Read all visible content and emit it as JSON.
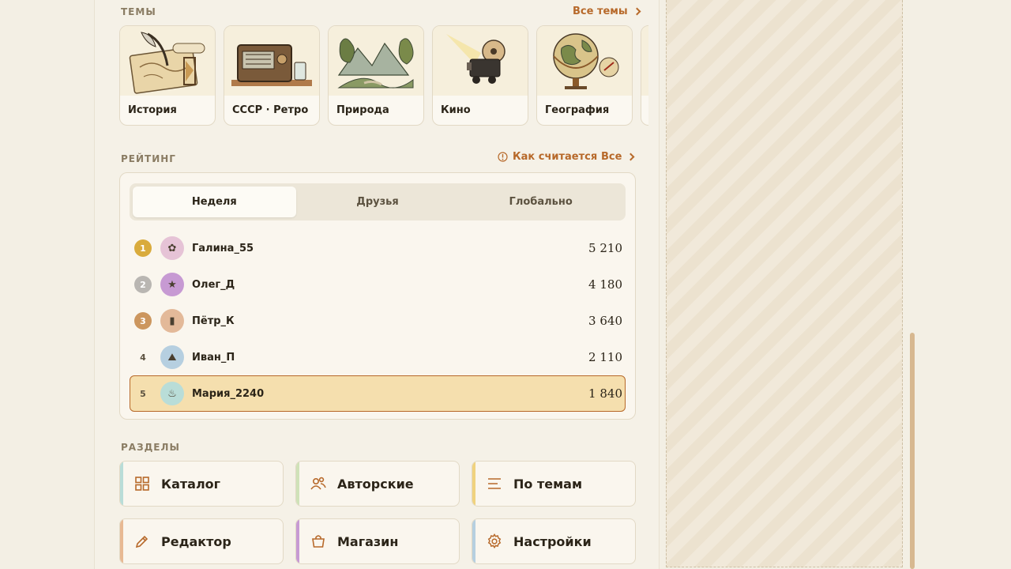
{
  "themes": {
    "label": "ТЕМЫ",
    "all_link": "Все темы",
    "items": [
      {
        "name": "История",
        "icon": "quill-map-icon"
      },
      {
        "name": "СССР · Ретро",
        "icon": "radio-icon"
      },
      {
        "name": "Природа",
        "icon": "landscape-icon"
      },
      {
        "name": "Кино",
        "icon": "film-camera-icon"
      },
      {
        "name": "География",
        "icon": "globe-icon"
      }
    ]
  },
  "rating": {
    "label": "РЕЙТИНГ",
    "how_link": "Как считается",
    "all_link": "Все",
    "tabs": [
      "Неделя",
      "Друзья",
      "Глобально"
    ],
    "active_tab": "Неделя",
    "rows": [
      {
        "rank": "1",
        "name": "Галина_55",
        "score": "5 210",
        "avatar_icon": "flower-icon",
        "avatar_color": "#e6c3d6",
        "rank_color": "#d9ab3c"
      },
      {
        "rank": "2",
        "name": "Олег_Д",
        "score": "4 180",
        "avatar_icon": "star-icon",
        "avatar_color": "#c79ad3",
        "rank_color": "#b9b6b2"
      },
      {
        "rank": "3",
        "name": "Пётр_К",
        "score": "3 640",
        "avatar_icon": "book-icon",
        "avatar_color": "#e3b999",
        "rank_color": "#cc965e"
      },
      {
        "rank": "4",
        "name": "Иван_П",
        "score": "2 110",
        "avatar_icon": "mountain-icon",
        "avatar_color": "#b6cfe0",
        "rank_color": ""
      },
      {
        "rank": "5",
        "name": "Мария_2240",
        "score": "1 840",
        "avatar_icon": "teapot-icon",
        "avatar_color": "#b9ddd8",
        "rank_color": ""
      }
    ]
  },
  "sections": {
    "label": "РАЗДЕЛЫ",
    "items": [
      {
        "label": "Каталог",
        "icon": "grid-icon",
        "accent": "#b9ddd8"
      },
      {
        "label": "Авторские",
        "icon": "users-icon",
        "accent": "#cfe2b8"
      },
      {
        "label": "По темам",
        "icon": "list-icon",
        "accent": "#f0d27e"
      },
      {
        "label": "Редактор",
        "icon": "pencil-icon",
        "accent": "#e8b993"
      },
      {
        "label": "Магазин",
        "icon": "bag-icon",
        "accent": "#c79ad3"
      },
      {
        "label": "Настройки",
        "icon": "gear-icon",
        "accent": "#b6cfe0"
      }
    ]
  },
  "colors": {
    "accent": "#b7692a",
    "highlight": "#f5dfae"
  }
}
